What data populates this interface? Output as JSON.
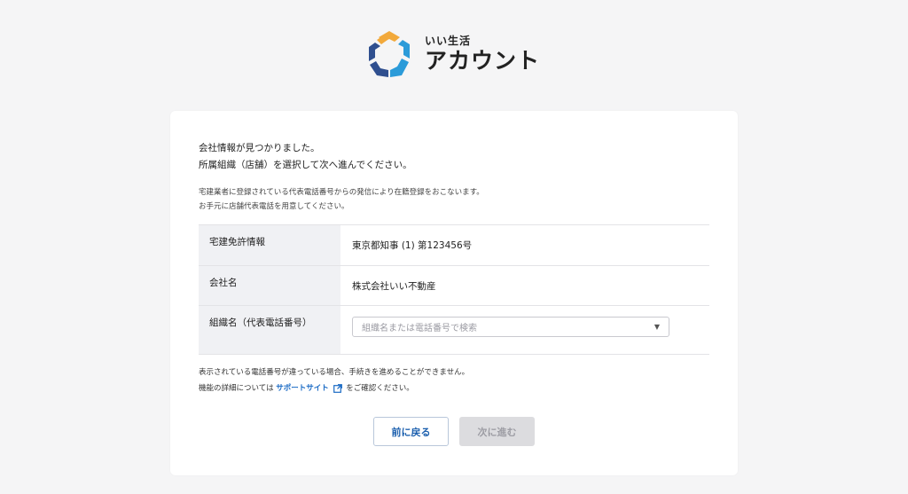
{
  "brand": {
    "sub": "いい生活",
    "main": "アカウント",
    "colors": {
      "orange": "#f2a93b",
      "blue": "#2b9bd9",
      "navy": "#2f4f8f"
    }
  },
  "intro": {
    "line1": "会社情報が見つかりました。",
    "line2": "所属組織（店舗）を選択して次へ進んでください。"
  },
  "note": {
    "line1": "宅建業者に登録されている代表電話番号からの発信により在籍登録をおこないます。",
    "line2": "お手元に店舗代表電話を用意してください。"
  },
  "table": {
    "license_label": "宅建免許情報",
    "license_value": "東京都知事 (1) 第123456号",
    "company_label": "会社名",
    "company_value": "株式会社いい不動産",
    "org_label": "組織名（代表電話番号）",
    "org_placeholder": "組織名または電話番号で検索"
  },
  "footer": {
    "line1": "表示されている電話番号が違っている場合、手続きを進めることができません。",
    "line2_before": "機能の詳細については",
    "link": "サポートサイト",
    "line2_after": "をご確認ください。"
  },
  "buttons": {
    "back": "前に戻る",
    "next": "次に進む"
  }
}
